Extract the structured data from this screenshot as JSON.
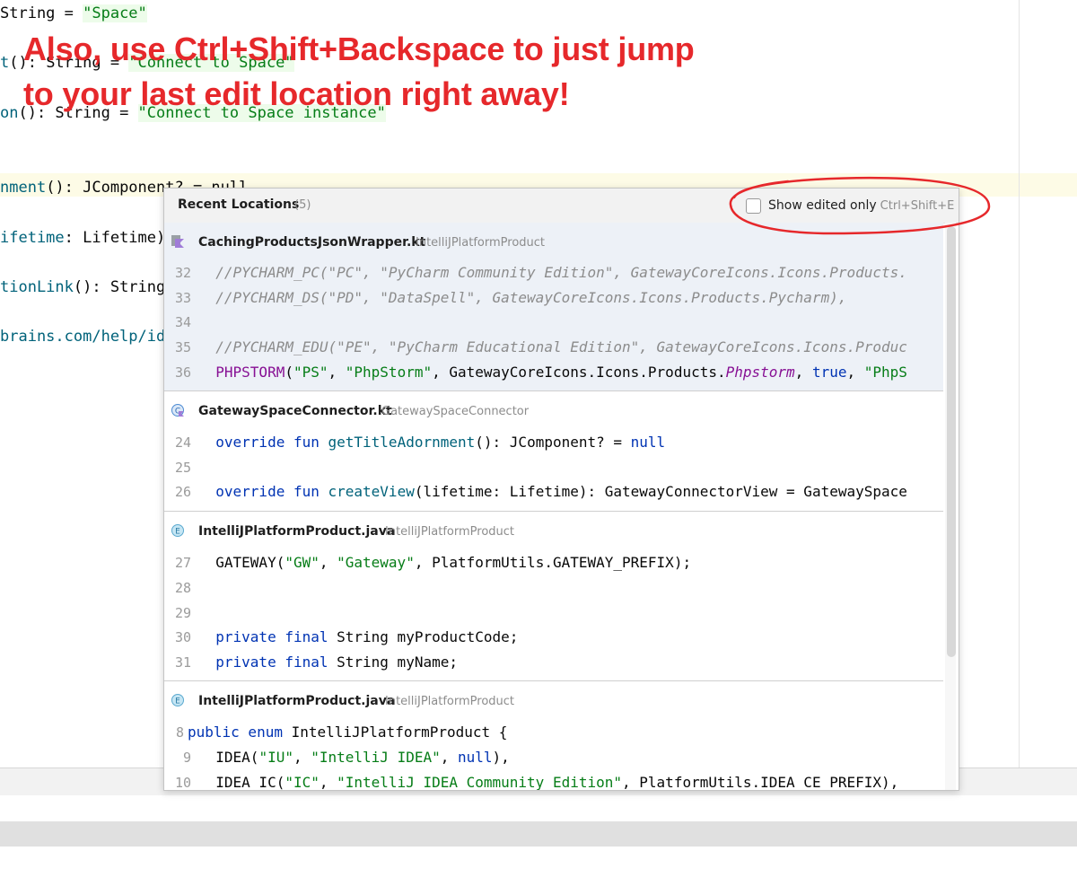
{
  "annotation": {
    "line1": "Also, use Ctrl+Shift+Backspace to just jump",
    "line2": "to your last edit location right away!",
    "color": "#e6282b"
  },
  "background_editor": {
    "lines": [
      {
        "pre": "String = ",
        "str": "\"Space\""
      },
      {
        "fn": "t",
        "pre": "(): String = ",
        "str": "\"Connect to Space\""
      },
      {
        "fn": "on",
        "pre": "(): String = ",
        "str": "\"Connect to Space instance\""
      },
      {
        "fn": "nment",
        "pre": "(): JComponent? = null"
      },
      {
        "fn": "ifetime",
        "pre": ": Lifetime): "
      },
      {
        "fn": "tionLink",
        "pre": "(): String "
      },
      {
        "fn": "brains.com/help/ide"
      }
    ]
  },
  "popup": {
    "title": "Recent Locations",
    "count": "(5)",
    "checkbox_label": "Show edited only",
    "checkbox_checked": false,
    "checkbox_shortcut": "Ctrl+Shift+E",
    "sections": [
      {
        "file": "CachingProductsJsonWrapper.kt",
        "context": "IntelliJPlatformProduct",
        "icon": "kotlin-file-icon",
        "lines": [
          {
            "n": "32",
            "code": "//PYCHARM_PC(\"PC\", \"PyCharm Community Edition\", GatewayCoreIcons.Icons.Products."
          },
          {
            "n": "33",
            "code": "//PYCHARM_DS(\"PD\", \"DataSpell\", GatewayCoreIcons.Icons.Products.Pycharm),"
          },
          {
            "n": "34",
            "code": ""
          },
          {
            "n": "35",
            "code": "//PYCHARM_EDU(\"PE\", \"PyCharm Educational Edition\", GatewayCoreIcons.Icons.Produc"
          },
          {
            "n": "36",
            "t1": "PHPSTORM",
            "t2": "(",
            "t3": "\"PS\"",
            "t4": ", ",
            "t5": "\"PhpStorm\"",
            "t6": ", GatewayCoreIcons.Icons.Products.",
            "t7": "Phpstorm",
            "t8": ", ",
            "t9": "true",
            "t10": ", ",
            "t11": "\"PhpS"
          }
        ]
      },
      {
        "file": "GatewaySpaceConnector.kt",
        "context": "GatewaySpaceConnector",
        "icon": "kotlin-class-icon",
        "lines": [
          {
            "n": "24",
            "k1": "override fun ",
            "f": "getTitleAdornment",
            "rest": "(): JComponent? = ",
            "k2": "null"
          },
          {
            "n": "25"
          },
          {
            "n": "26",
            "k1": "override fun ",
            "f": "createView",
            "rest": "(lifetime: Lifetime): GatewayConnectorView = GatewaySpace"
          }
        ]
      },
      {
        "file": "IntelliJPlatformProduct.java",
        "context": "IntelliJPlatformProduct",
        "icon": "java-enum-icon",
        "lines": [
          {
            "n": "27",
            "a": "GATEWAY(",
            "b": "\"GW\"",
            "c": ", ",
            "d": "\"Gateway\"",
            "e": ", PlatformUtils.GATEWAY_PREFIX);"
          },
          {
            "n": "28"
          },
          {
            "n": "29"
          },
          {
            "n": "30",
            "k": "private final ",
            "rest": "String myProductCode;"
          },
          {
            "n": "31",
            "k": "private final ",
            "rest": "String myName;"
          }
        ]
      },
      {
        "file": "IntelliJPlatformProduct.java",
        "context": "IntelliJPlatformProduct",
        "icon": "java-enum-icon",
        "lines": [
          {
            "n": "8",
            "k": "public enum ",
            "rest": "IntelliJPlatformProduct {"
          },
          {
            "n": "9",
            "a": "IDEA(",
            "b": "\"IU\"",
            "c": ", ",
            "d": "\"IntelliJ IDEA\"",
            "e": ", ",
            "f": "null",
            "g": "),"
          },
          {
            "n": "10",
            "a": "IDEA_IC(",
            "b": "\"IC\"",
            "c": ", ",
            "d": "\"IntelliJ IDEA Community Edition\"",
            "e": ", PlatformUtils.IDEA_CE_PREFIX),"
          }
        ]
      }
    ]
  }
}
